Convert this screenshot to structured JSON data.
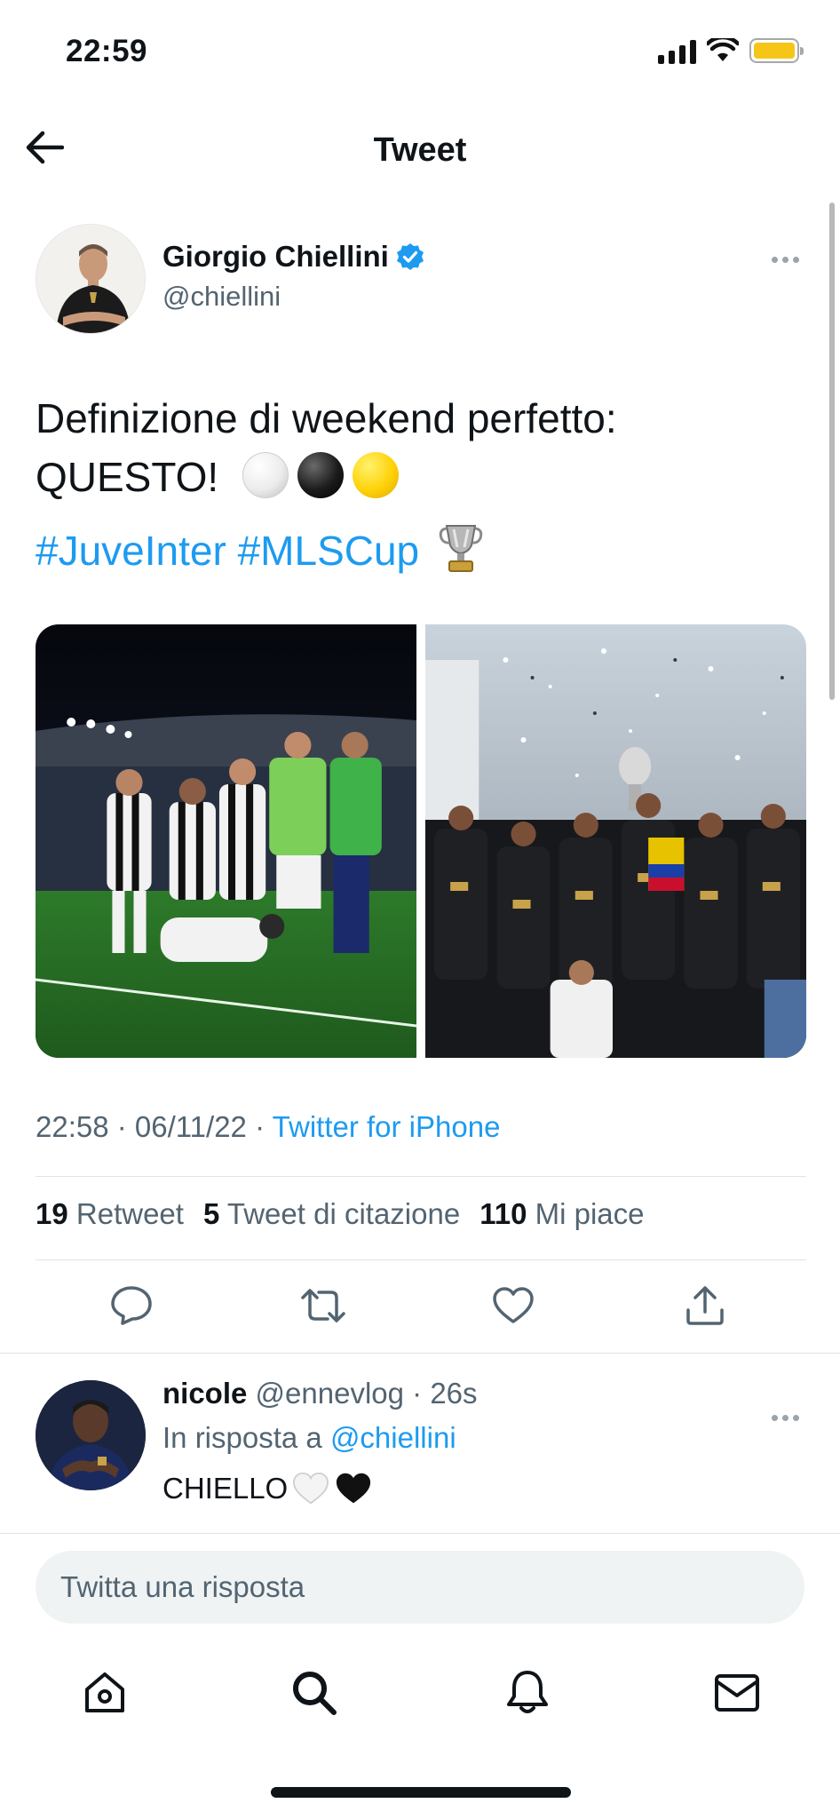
{
  "status_bar": {
    "time": "22:59"
  },
  "header": {
    "title": "Tweet"
  },
  "tweet": {
    "author_name": "Giorgio Chiellini",
    "author_handle": "@chiellini",
    "text_line1": "Definizione di weekend perfetto:",
    "text_line2": "QUESTO!",
    "hashtags": [
      "#JuveInter",
      "#MLSCup"
    ],
    "timestamp": "22:58 · 06/11/22 · ",
    "source": "Twitter for iPhone",
    "stats": {
      "retweets": {
        "count": "19",
        "label": "Retweet"
      },
      "quotes": {
        "count": "5",
        "label": "Tweet di citazione"
      },
      "likes": {
        "count": "110",
        "label": "Mi piace"
      }
    }
  },
  "reply": {
    "author_name": "nicole",
    "author_handle": "@ennevlog",
    "time": "· 26s",
    "in_reply_prefix": "In risposta a ",
    "in_reply_handle": "@chiellini",
    "text": "CHIELLO"
  },
  "compose": {
    "placeholder": "Twitta una risposta"
  },
  "colors": {
    "link": "#1d9bf0",
    "secondary_text": "#536471",
    "verified": "#1d9bf0",
    "battery": "#f5c518"
  }
}
